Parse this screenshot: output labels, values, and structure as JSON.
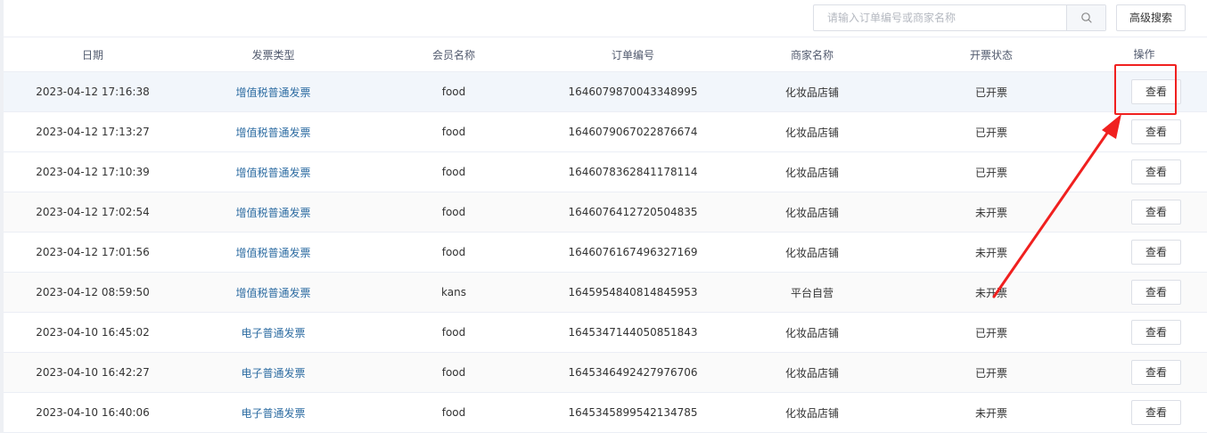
{
  "toolbar": {
    "search_placeholder": "请输入订单编号或商家名称",
    "search_icon": "search-icon",
    "advanced_search_label": "高级搜索"
  },
  "table": {
    "columns": [
      "日期",
      "发票类型",
      "会员名称",
      "订单编号",
      "商家名称",
      "开票状态",
      "操作"
    ],
    "rows": [
      {
        "date": "2023-04-12 17:16:38",
        "invoice_type": "增值税普通发票",
        "member": "food",
        "order_no": "1646079870043348995",
        "merchant": "化妆品店铺",
        "status": "已开票",
        "action": "查看"
      },
      {
        "date": "2023-04-12 17:13:27",
        "invoice_type": "增值税普通发票",
        "member": "food",
        "order_no": "1646079067022876674",
        "merchant": "化妆品店铺",
        "status": "已开票",
        "action": "查看"
      },
      {
        "date": "2023-04-12 17:10:39",
        "invoice_type": "增值税普通发票",
        "member": "food",
        "order_no": "1646078362841178114",
        "merchant": "化妆品店铺",
        "status": "已开票",
        "action": "查看"
      },
      {
        "date": "2023-04-12 17:02:54",
        "invoice_type": "增值税普通发票",
        "member": "food",
        "order_no": "1646076412720504835",
        "merchant": "化妆品店铺",
        "status": "未开票",
        "action": "查看"
      },
      {
        "date": "2023-04-12 17:01:56",
        "invoice_type": "增值税普通发票",
        "member": "food",
        "order_no": "1646076167496327169",
        "merchant": "化妆品店铺",
        "status": "未开票",
        "action": "查看"
      },
      {
        "date": "2023-04-12 08:59:50",
        "invoice_type": "增值税普通发票",
        "member": "kans",
        "order_no": "1645954840814845953",
        "merchant": "平台自营",
        "status": "未开票",
        "action": "查看"
      },
      {
        "date": "2023-04-10 16:45:02",
        "invoice_type": "电子普通发票",
        "member": "food",
        "order_no": "1645347144050851843",
        "merchant": "化妆品店铺",
        "status": "已开票",
        "action": "查看"
      },
      {
        "date": "2023-04-10 16:42:27",
        "invoice_type": "电子普通发票",
        "member": "food",
        "order_no": "1645346492427976706",
        "merchant": "化妆品店铺",
        "status": "已开票",
        "action": "查看"
      },
      {
        "date": "2023-04-10 16:40:06",
        "invoice_type": "电子普通发票",
        "member": "food",
        "order_no": "1645345899542134785",
        "merchant": "化妆品店铺",
        "status": "未开票",
        "action": "查看"
      }
    ]
  },
  "colors": {
    "link": "#2d6ca2",
    "annotation": "#f0201f",
    "border": "#dcdfe6"
  }
}
